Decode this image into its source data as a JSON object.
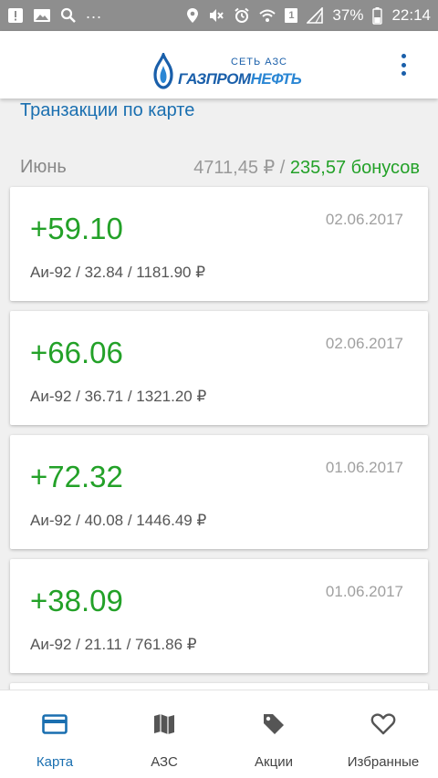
{
  "status_bar": {
    "battery_percent": "37%",
    "time": "22:14",
    "sim_slot": "1",
    "icons_left": [
      "alert-icon",
      "image-icon",
      "search-icon"
    ],
    "icons_right": [
      "location-icon",
      "mute-icon",
      "alarm-icon",
      "wifi-icon",
      "sim-icon",
      "signal-icon",
      "battery-icon"
    ]
  },
  "app_bar": {
    "logo_sub": "СЕТЬ АЗС",
    "logo_main_part1": "ГАЗПРОМ",
    "logo_main_part2": "НЕФТЬ"
  },
  "section": {
    "title": "Транзакции по карте"
  },
  "summary": {
    "month": "Июнь",
    "total": "4711,45 ₽ / ",
    "bonus": "235,57 бонусов"
  },
  "transactions": [
    {
      "amount": "+59.10",
      "date": "02.06.2017",
      "details": "Аи-92 / 32.84 / 1181.90 ₽"
    },
    {
      "amount": "+66.06",
      "date": "02.06.2017",
      "details": "Аи-92 / 36.71 / 1321.20 ₽"
    },
    {
      "amount": "+72.32",
      "date": "01.06.2017",
      "details": "Аи-92 / 40.08 / 1446.49 ₽"
    },
    {
      "amount": "+38.09",
      "date": "01.06.2017",
      "details": "Аи-92 / 21.11 / 761.86 ₽"
    }
  ],
  "bottom_nav": [
    {
      "label": "Карта",
      "icon": "card-icon",
      "active": true
    },
    {
      "label": "АЗС",
      "icon": "map-icon",
      "active": false
    },
    {
      "label": "Акции",
      "icon": "tag-icon",
      "active": false
    },
    {
      "label": "Избранные",
      "icon": "heart-icon",
      "active": false
    }
  ],
  "colors": {
    "accent": "#1a6fb0",
    "bonus_green": "#23a128",
    "status_bar": "#8e8e8e"
  }
}
